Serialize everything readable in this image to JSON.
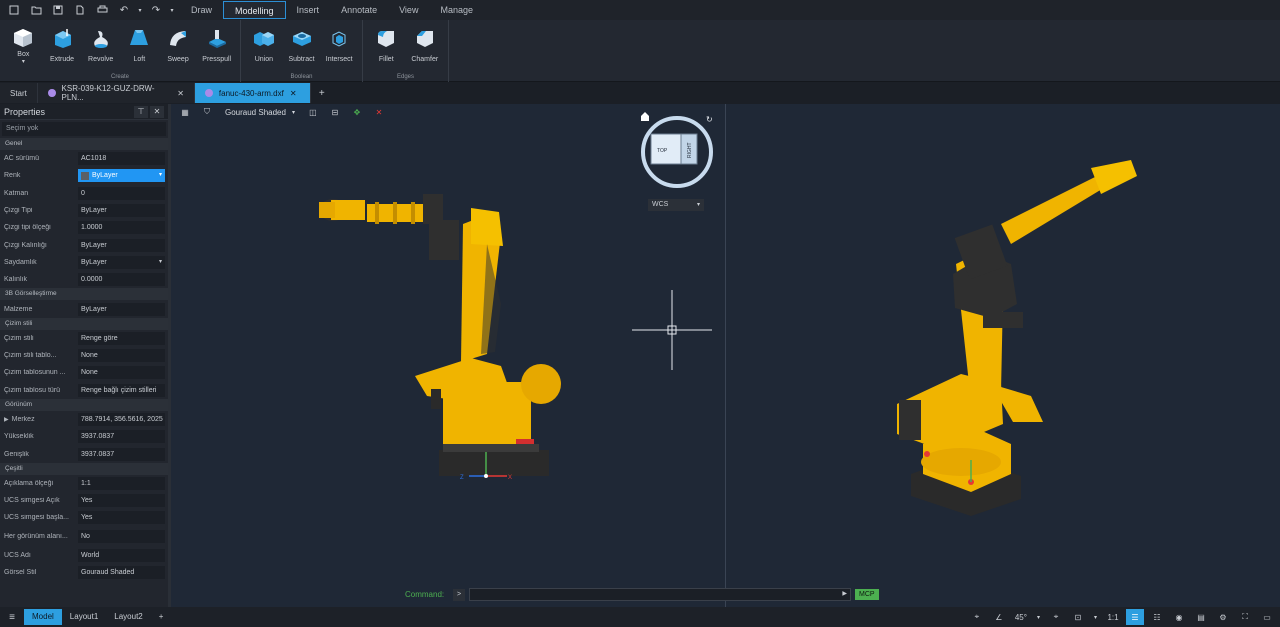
{
  "menus": [
    "Draw",
    "Modelling",
    "Insert",
    "Annotate",
    "View",
    "Manage"
  ],
  "ribbon": {
    "create": {
      "label": "Create",
      "tools": [
        "Box",
        "Extrude",
        "Revolve",
        "Loft",
        "Sweep",
        "Presspull"
      ]
    },
    "boolean": {
      "label": "Boolean",
      "tools": [
        "Union",
        "Subtract",
        "Intersect"
      ]
    },
    "edges": {
      "label": "Edges",
      "tools": [
        "Fillet",
        "Chamfer"
      ]
    }
  },
  "tabs": {
    "start": "Start",
    "doc1": "KSR-039-K12-GUZ-DRW-PLN...",
    "doc2": "fanuc-430-arm.dxf",
    "plus": "+"
  },
  "properties": {
    "title": "Properties",
    "selection": "Seçim yok",
    "sections": {
      "genel": "Genel",
      "gorsel3b": "3B Görselleştirme",
      "cizim_stili": "Çizim stili",
      "gorunum": "Görünüm",
      "cesitli": "Çeşitli"
    },
    "rows": {
      "ac_surumu": {
        "k": "AC sürümü",
        "v": "AC1018"
      },
      "renk": {
        "k": "Renk",
        "v": "ByLayer"
      },
      "katman": {
        "k": "Katman",
        "v": "0"
      },
      "cizgi_tipi": {
        "k": "Çizgi Tipi",
        "v": "ByLayer"
      },
      "cizgi_tipi_olcegi": {
        "k": "Çizgi tipi ölçeği",
        "v": "1.0000"
      },
      "cizgi_kalinligi": {
        "k": "Çizgi Kalınlığı",
        "v": "ByLayer"
      },
      "saydamlik": {
        "k": "Saydamlık",
        "v": "ByLayer"
      },
      "kalinlik": {
        "k": "Kalınlık",
        "v": "0.0000"
      },
      "malzeme": {
        "k": "Malzeme",
        "v": "ByLayer"
      },
      "cizim_stili": {
        "k": "Çizim stili",
        "v": "Renge göre"
      },
      "cizim_stili_tablo": {
        "k": "Çizim stili tablo...",
        "v": "None"
      },
      "cizim_tablosunun": {
        "k": "Çizim tablosunun ...",
        "v": "None"
      },
      "cizim_tablosu_turu": {
        "k": "Çizim tablosu türü",
        "v": "Renge bağlı çizim stilleri"
      },
      "merkez": {
        "k": "Merkez",
        "v": "788.7914, 356.5616, 2025"
      },
      "yukseklik": {
        "k": "Yükseklik",
        "v": "3937.0837"
      },
      "genislik": {
        "k": "Genişlik",
        "v": "3937.0837"
      },
      "aciklama_olcegi": {
        "k": "Açıklama ölçeği",
        "v": "1:1"
      },
      "ucs_simgesi_acik": {
        "k": "UCS simgesi Açık",
        "v": "Yes"
      },
      "ucs_simgesi_basla": {
        "k": "UCS simgesi başla...",
        "v": "Yes"
      },
      "her_gorunum": {
        "k": "Her görünüm alanı...",
        "v": "No"
      },
      "ucs_adi": {
        "k": "UCS Adı",
        "v": "World"
      },
      "gorsel_stil": {
        "k": "Görsel Stil",
        "v": "Gouraud Shaded"
      }
    }
  },
  "viewport": {
    "visual_style": "Gouraud Shaded",
    "wcs": "WCS",
    "viewcube_top": "TOP",
    "viewcube_right": "RIGHT",
    "axis_x": "X",
    "axis_z": "Z"
  },
  "command": {
    "label": "Command:",
    "mcp": "MCP"
  },
  "status": {
    "layouts": [
      "Model",
      "Layout1",
      "Layout2"
    ],
    "plus": "+",
    "angle": "45°",
    "scale": "1:1"
  },
  "colors": {
    "accent": "#2d9fe0",
    "robot": "#f0b400",
    "viewport_bg": "#1f2836"
  }
}
